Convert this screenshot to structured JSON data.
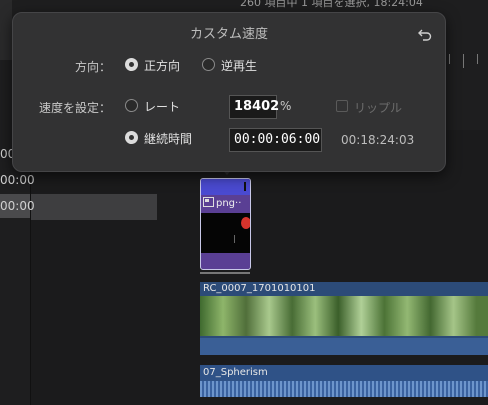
{
  "status_bar": {
    "text": "260 項目中 1 項目を選択, 18:24:04"
  },
  "left_panel": {
    "timecodes": [
      "00:00",
      "00:00",
      "00:00"
    ]
  },
  "popover": {
    "title": "カスタム速度",
    "direction": {
      "label": "方向：",
      "options": [
        {
          "label": "正方向",
          "selected": true
        },
        {
          "label": "逆再生",
          "selected": false
        }
      ]
    },
    "speed": {
      "label": "速度を設定：",
      "rate_label": "レート",
      "rate_selected": false,
      "rate_value": "18402",
      "rate_unit": "%",
      "ripple_label": "リップル",
      "ripple_checked": false,
      "duration_label": "継続時間",
      "duration_selected": true,
      "duration_value": "00:00:06:00",
      "total_time": "00:18:24:03"
    }
  },
  "clips": {
    "png": {
      "name": "png··"
    },
    "rc": {
      "name": "RC_0007_1701010101"
    },
    "spherism": {
      "name": "07_Spherism"
    }
  }
}
